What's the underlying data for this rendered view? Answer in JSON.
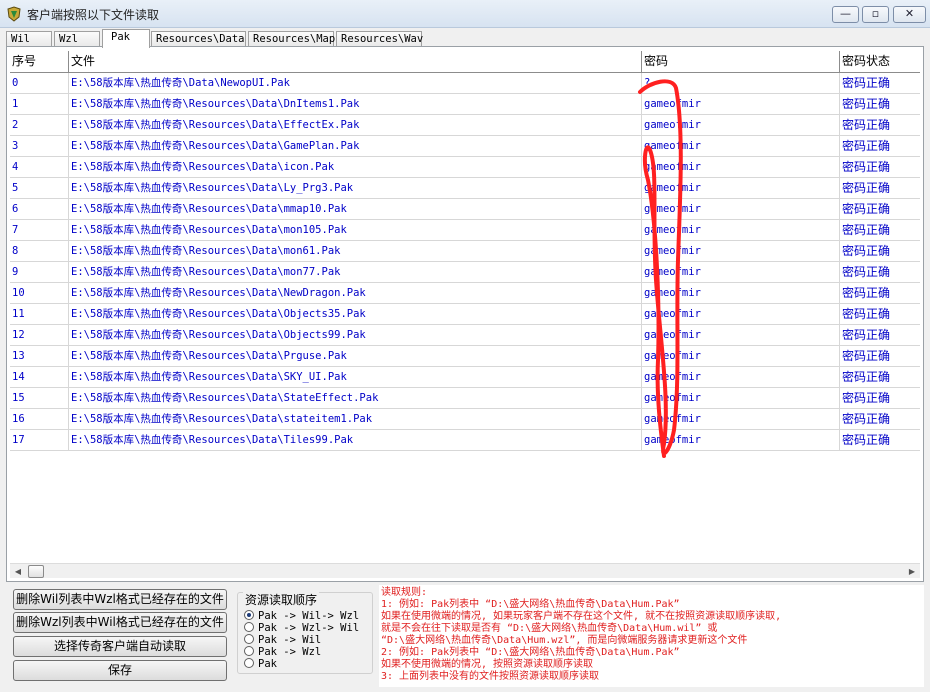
{
  "window": {
    "title": "客户端按照以下文件读取"
  },
  "tabs": [
    {
      "label": "Wil"
    },
    {
      "label": "Wzl"
    },
    {
      "label": "Pak"
    },
    {
      "label": "Resources\\Data"
    },
    {
      "label": "Resources\\Map"
    },
    {
      "label": "Resources\\Wav"
    }
  ],
  "active_tab": "Pak",
  "grid": {
    "columns": [
      "序号",
      "文件",
      "密码",
      "密码状态"
    ],
    "rows": [
      {
        "idx": "0",
        "file": "E:\\58版本库\\热血传奇\\Data\\NewopUI.Pak",
        "pwd": "?",
        "status": "密码正确"
      },
      {
        "idx": "1",
        "file": "E:\\58版本库\\热血传奇\\Resources\\Data\\DnItems1.Pak",
        "pwd": "gameofmir",
        "status": "密码正确"
      },
      {
        "idx": "2",
        "file": "E:\\58版本库\\热血传奇\\Resources\\Data\\EffectEx.Pak",
        "pwd": "gameofmir",
        "status": "密码正确"
      },
      {
        "idx": "3",
        "file": "E:\\58版本库\\热血传奇\\Resources\\Data\\GamePlan.Pak",
        "pwd": "gameofmir",
        "status": "密码正确"
      },
      {
        "idx": "4",
        "file": "E:\\58版本库\\热血传奇\\Resources\\Data\\icon.Pak",
        "pwd": "gameofmir",
        "status": "密码正确"
      },
      {
        "idx": "5",
        "file": "E:\\58版本库\\热血传奇\\Resources\\Data\\Ly_Prg3.Pak",
        "pwd": "gameofmir",
        "status": "密码正确"
      },
      {
        "idx": "6",
        "file": "E:\\58版本库\\热血传奇\\Resources\\Data\\mmap10.Pak",
        "pwd": "gameofmir",
        "status": "密码正确"
      },
      {
        "idx": "7",
        "file": "E:\\58版本库\\热血传奇\\Resources\\Data\\mon105.Pak",
        "pwd": "gameofmir",
        "status": "密码正确"
      },
      {
        "idx": "8",
        "file": "E:\\58版本库\\热血传奇\\Resources\\Data\\mon61.Pak",
        "pwd": "gameofmir",
        "status": "密码正确"
      },
      {
        "idx": "9",
        "file": "E:\\58版本库\\热血传奇\\Resources\\Data\\mon77.Pak",
        "pwd": "gameofmir",
        "status": "密码正确"
      },
      {
        "idx": "10",
        "file": "E:\\58版本库\\热血传奇\\Resources\\Data\\NewDragon.Pak",
        "pwd": "gameofmir",
        "status": "密码正确"
      },
      {
        "idx": "11",
        "file": "E:\\58版本库\\热血传奇\\Resources\\Data\\Objects35.Pak",
        "pwd": "gameofmir",
        "status": "密码正确"
      },
      {
        "idx": "12",
        "file": "E:\\58版本库\\热血传奇\\Resources\\Data\\Objects99.Pak",
        "pwd": "gameofmir",
        "status": "密码正确"
      },
      {
        "idx": "13",
        "file": "E:\\58版本库\\热血传奇\\Resources\\Data\\Prguse.Pak",
        "pwd": "gameofmir",
        "status": "密码正确"
      },
      {
        "idx": "14",
        "file": "E:\\58版本库\\热血传奇\\Resources\\Data\\SKY_UI.Pak",
        "pwd": "gameofmir",
        "status": "密码正确"
      },
      {
        "idx": "15",
        "file": "E:\\58版本库\\热血传奇\\Resources\\Data\\StateEffect.Pak",
        "pwd": "gameofmir",
        "status": "密码正确"
      },
      {
        "idx": "16",
        "file": "E:\\58版本库\\热血传奇\\Resources\\Data\\stateitem1.Pak",
        "pwd": "gameofmir",
        "status": "密码正确"
      },
      {
        "idx": "17",
        "file": "E:\\58版本库\\热血传奇\\Resources\\Data\\Tiles99.Pak",
        "pwd": "gameofmir",
        "status": "密码正确"
      }
    ]
  },
  "buttons": {
    "delete_wil": "删除Wil列表中Wzl格式已经存在的文件",
    "delete_wzl": "删除Wzl列表中Wil格式已经存在的文件",
    "auto_read": "选择传奇客户端自动读取",
    "save": "保存"
  },
  "read_order": {
    "title": "资源读取顺序",
    "options": [
      "Pak -> Wil-> Wzl",
      "Pak -> Wzl-> Wil",
      "Pak -> Wil",
      "Pak -> Wzl",
      "Pak"
    ],
    "selected": "Pak -> Wil-> Wzl"
  },
  "rules": [
    "读取规则:",
    "1: 例如: Pak列表中 “D:\\盛大网络\\热血传奇\\Data\\Hum.Pak”",
    "   如果在使用微端的情况, 如果玩家客户端不存在这个文件, 就不在按照资源读取顺序读取,",
    "   就是不会在往下读取是否有 “D:\\盛大网络\\热血传奇\\Data\\Hum.wil” 或",
    "   “D:\\盛大网络\\热血传奇\\Data\\Hum.wzl”, 而是向微端服务器请求更新这个文件",
    "2: 例如: Pak列表中 “D:\\盛大网络\\热血传奇\\Data\\Hum.Pak”",
    "   如果不使用微端的情况, 按照资源读取顺序读取",
    "3: 上面列表中没有的文件按照资源读取顺序读取"
  ],
  "colors": {
    "link_blue": "#0000c8",
    "rule_red": "#e02020",
    "annotation_red": "#ff2020"
  }
}
